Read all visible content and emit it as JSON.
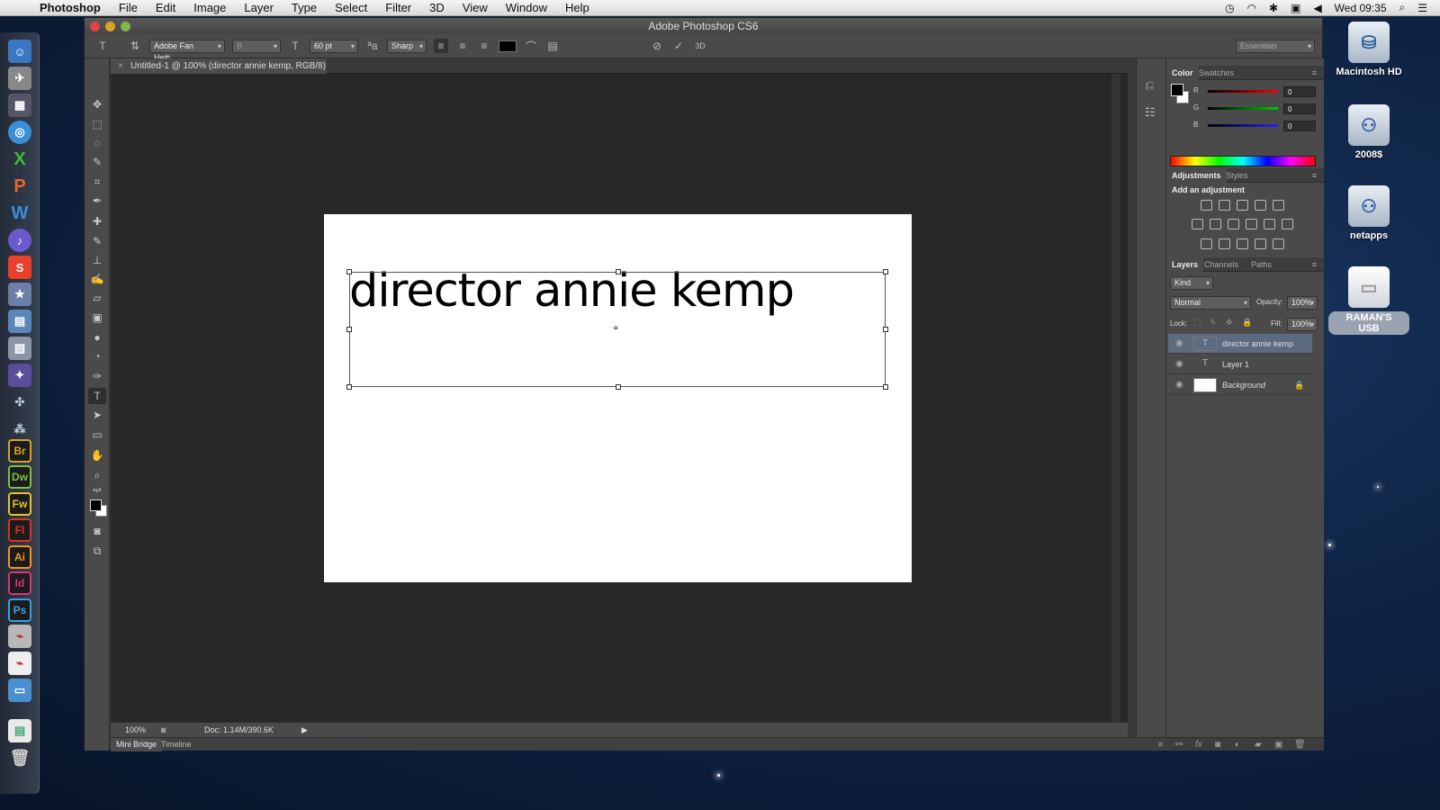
{
  "menubar": {
    "app_name": "Photoshop",
    "menus": [
      "File",
      "Edit",
      "Image",
      "Layer",
      "Type",
      "Select",
      "Filter",
      "3D",
      "View",
      "Window",
      "Help"
    ],
    "clock": "Wed 09:35"
  },
  "window": {
    "title": "Adobe Photoshop CS6"
  },
  "options_bar": {
    "font_family": "Adobe Fan Heiti...",
    "font_style": "B",
    "font_size": "60 pt",
    "anti_alias": "Sharp",
    "three_d": "3D",
    "workspace": "Essentials"
  },
  "document": {
    "tab_title": "Untitled-1 @ 100% (director annie kemp, RGB/8) *",
    "canvas_text": "director annie kemp",
    "zoom": "100%",
    "doc_size": "Doc: 1.14M/390.6K"
  },
  "bottom_tabs": [
    "Mini Bridge",
    "Timeline"
  ],
  "color_panel": {
    "tabs": [
      "Color",
      "Swatches"
    ],
    "channels": [
      {
        "label": "R",
        "value": "0",
        "color": "#d22"
      },
      {
        "label": "G",
        "value": "0",
        "color": "#2a2"
      },
      {
        "label": "B",
        "value": "0",
        "color": "#24d"
      }
    ]
  },
  "adjustments_panel": {
    "tabs": [
      "Adjustments",
      "Styles"
    ],
    "heading": "Add an adjustment"
  },
  "layers_panel": {
    "tabs": [
      "Layers",
      "Channels",
      "Paths"
    ],
    "kind_filter": "Kind",
    "blend_mode": "Normal",
    "opacity_label": "Opacity:",
    "opacity": "100%",
    "lock_label": "Lock:",
    "fill_label": "Fill:",
    "fill": "100%",
    "layers": [
      {
        "name": "director annie kemp",
        "type": "T",
        "selected": true
      },
      {
        "name": "Layer 1",
        "type": "T",
        "selected": false
      },
      {
        "name": "Background",
        "type": "image",
        "selected": false
      }
    ]
  },
  "desktop": {
    "icons": [
      "Macintosh HD",
      "2008$",
      "netapps",
      "RAMAN'S USB"
    ]
  },
  "dock_apps": [
    "Br",
    "Dw",
    "Fw",
    "Fl",
    "Ai",
    "Id",
    "Ps"
  ]
}
